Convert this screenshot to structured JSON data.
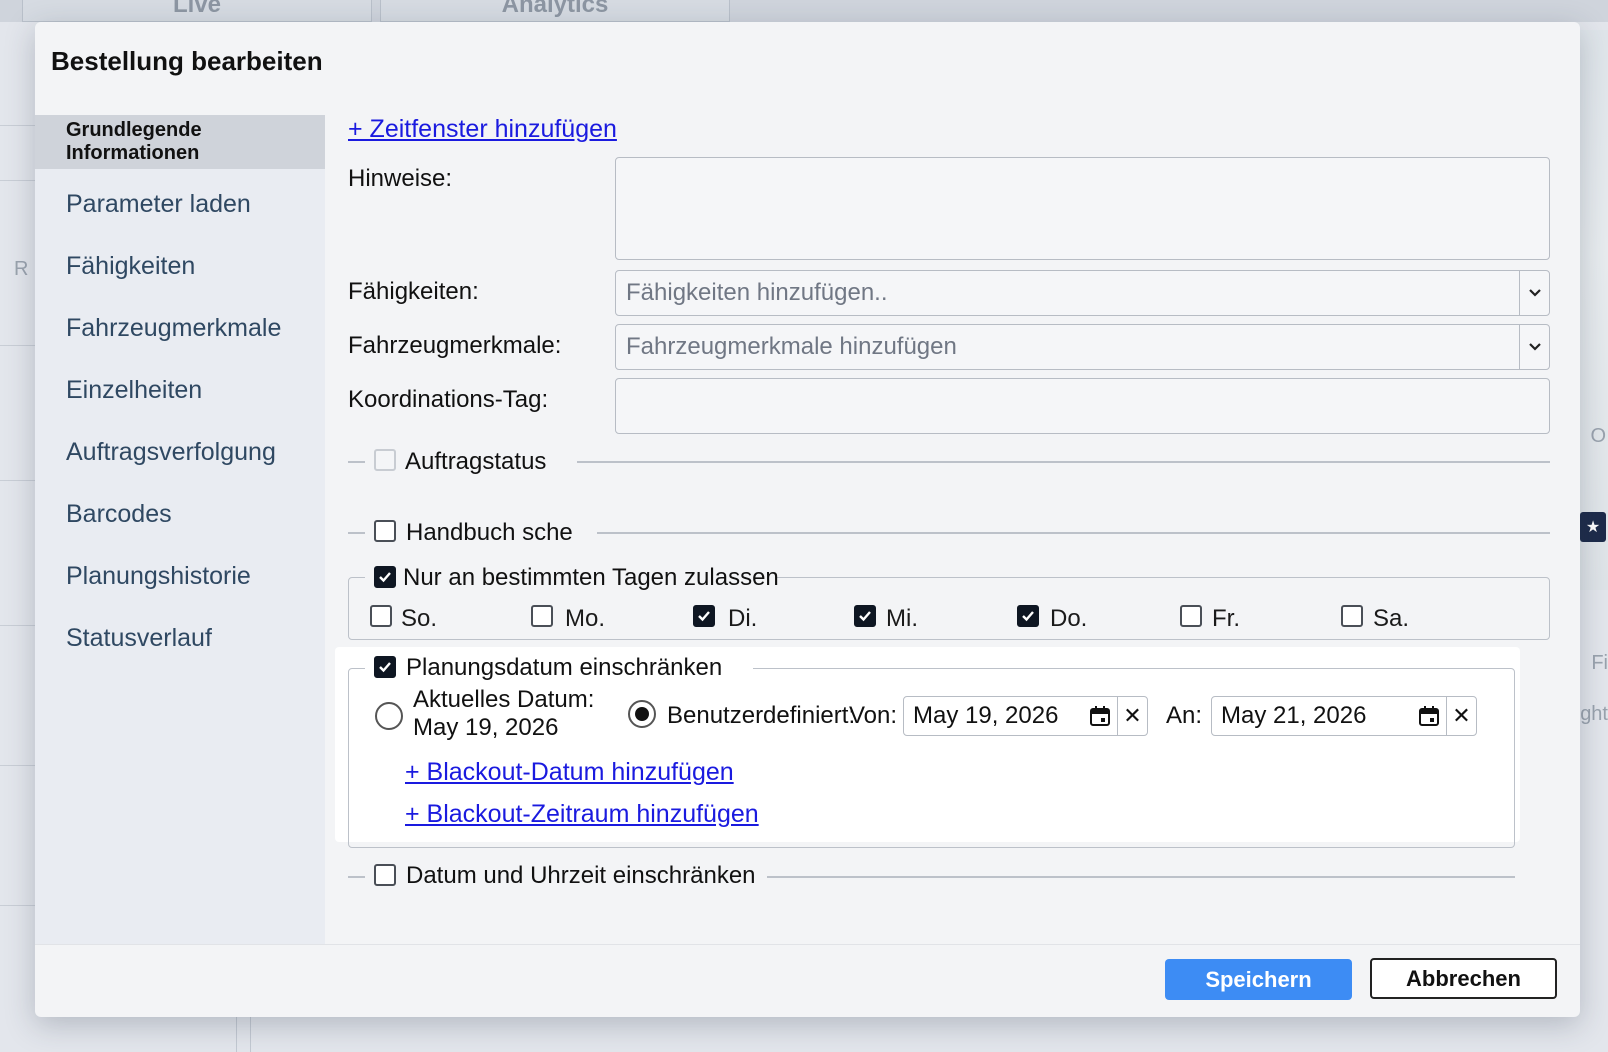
{
  "background": {
    "tabs": [
      "Live",
      "Analytics"
    ],
    "fragments": [
      "R",
      "O",
      "Fi",
      "ght"
    ]
  },
  "dialog": {
    "title": "Bestellung bearbeiten",
    "sidebar": {
      "items": [
        {
          "label": "Grundlegende Informationen",
          "active": true
        },
        {
          "label": "Parameter laden",
          "active": false
        },
        {
          "label": "Fähigkeiten",
          "active": false
        },
        {
          "label": "Fahrzeugmerkmale",
          "active": false
        },
        {
          "label": "Einzelheiten",
          "active": false
        },
        {
          "label": "Auftragsverfolgung",
          "active": false
        },
        {
          "label": "Barcodes",
          "active": false
        },
        {
          "label": "Planungshistorie",
          "active": false
        },
        {
          "label": "Statusverlauf",
          "active": false
        }
      ]
    },
    "form": {
      "add_time_window_link": "+ Zeitfenster hinzufügen",
      "notes_label": "Hinweise:",
      "notes_value": "",
      "skills_label": "Fähigkeiten:",
      "skills_placeholder": "Fähigkeiten hinzufügen..",
      "vehicle_features_label": "Fahrzeugmerkmale:",
      "vehicle_features_placeholder": "Fahrzeugmerkmale hinzufügen",
      "coordination_tag_label": "Koordinations-Tag:",
      "coordination_tag_value": "",
      "order_status": {
        "label": "Auftragstatus",
        "checked": false,
        "disabled": true
      },
      "manual_schedule": {
        "label": "Handbuch sche",
        "checked": false
      },
      "allowed_days": {
        "label": "Nur an bestimmten Tagen zulassen",
        "checked": true,
        "days": [
          {
            "label": "So.",
            "checked": false
          },
          {
            "label": "Mo.",
            "checked": false
          },
          {
            "label": "Di.",
            "checked": true
          },
          {
            "label": "Mi.",
            "checked": true
          },
          {
            "label": "Do.",
            "checked": true
          },
          {
            "label": "Fr.",
            "checked": false
          },
          {
            "label": "Sa.",
            "checked": false
          }
        ]
      },
      "restrict_planning_date": {
        "label": "Planungsdatum einschränken",
        "checked": true,
        "current_date_label": "Aktuelles Datum:",
        "current_date_value": "May 19, 2026",
        "current_date_selected": false,
        "custom_label": "Benutzerdefiniert:",
        "custom_selected": true,
        "from_label": "Von:",
        "from_value": "May 19, 2026",
        "to_label": "An:",
        "to_value": "May 21, 2026",
        "clear_symbol": "✕",
        "add_blackout_date_link": "+ Blackout-Datum hinzufügen",
        "add_blackout_period_link": "+ Blackout-Zeitraum hinzufügen"
      },
      "restrict_datetime": {
        "label": "Datum und Uhrzeit einschränken",
        "checked": false
      }
    },
    "buttons": {
      "save": "Speichern",
      "cancel": "Abbrechen"
    },
    "colors": {
      "primary": "#3d8cf4",
      "link": "#1a1adf",
      "sidebar_active_bg": "#cfd3da"
    }
  }
}
